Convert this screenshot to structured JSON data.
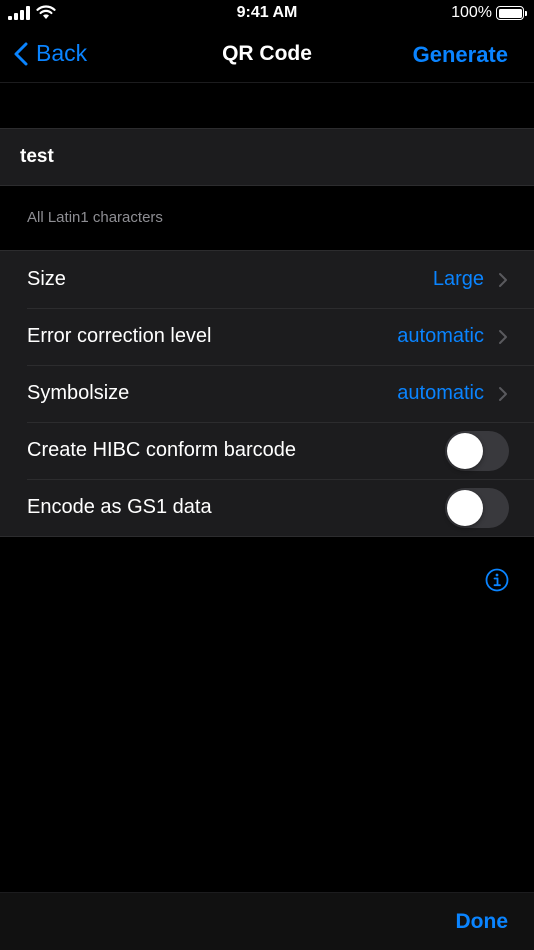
{
  "status_bar": {
    "time": "9:41 AM",
    "battery_percent": "100%",
    "icons": [
      "signal-icon",
      "wifi-icon",
      "battery-icon"
    ]
  },
  "nav": {
    "back_label": "Back",
    "title": "QR Code",
    "generate_label": "Generate"
  },
  "input": {
    "value": "test"
  },
  "footer_note": "All Latin1 characters",
  "settings": {
    "size": {
      "label": "Size",
      "value": "Large"
    },
    "error_correction": {
      "label": "Error correction level",
      "value": "automatic"
    },
    "symbolsize": {
      "label": "Symbolsize",
      "value": "automatic"
    },
    "hibc": {
      "label": "Create HIBC conform barcode",
      "enabled": false
    },
    "gs1": {
      "label": "Encode as GS1 data",
      "enabled": false
    }
  },
  "toolbar": {
    "done_label": "Done"
  },
  "colors": {
    "accent": "#0a84ff",
    "background": "#000000",
    "cell": "#1c1c1e",
    "secondary_text": "#8e8e93"
  }
}
